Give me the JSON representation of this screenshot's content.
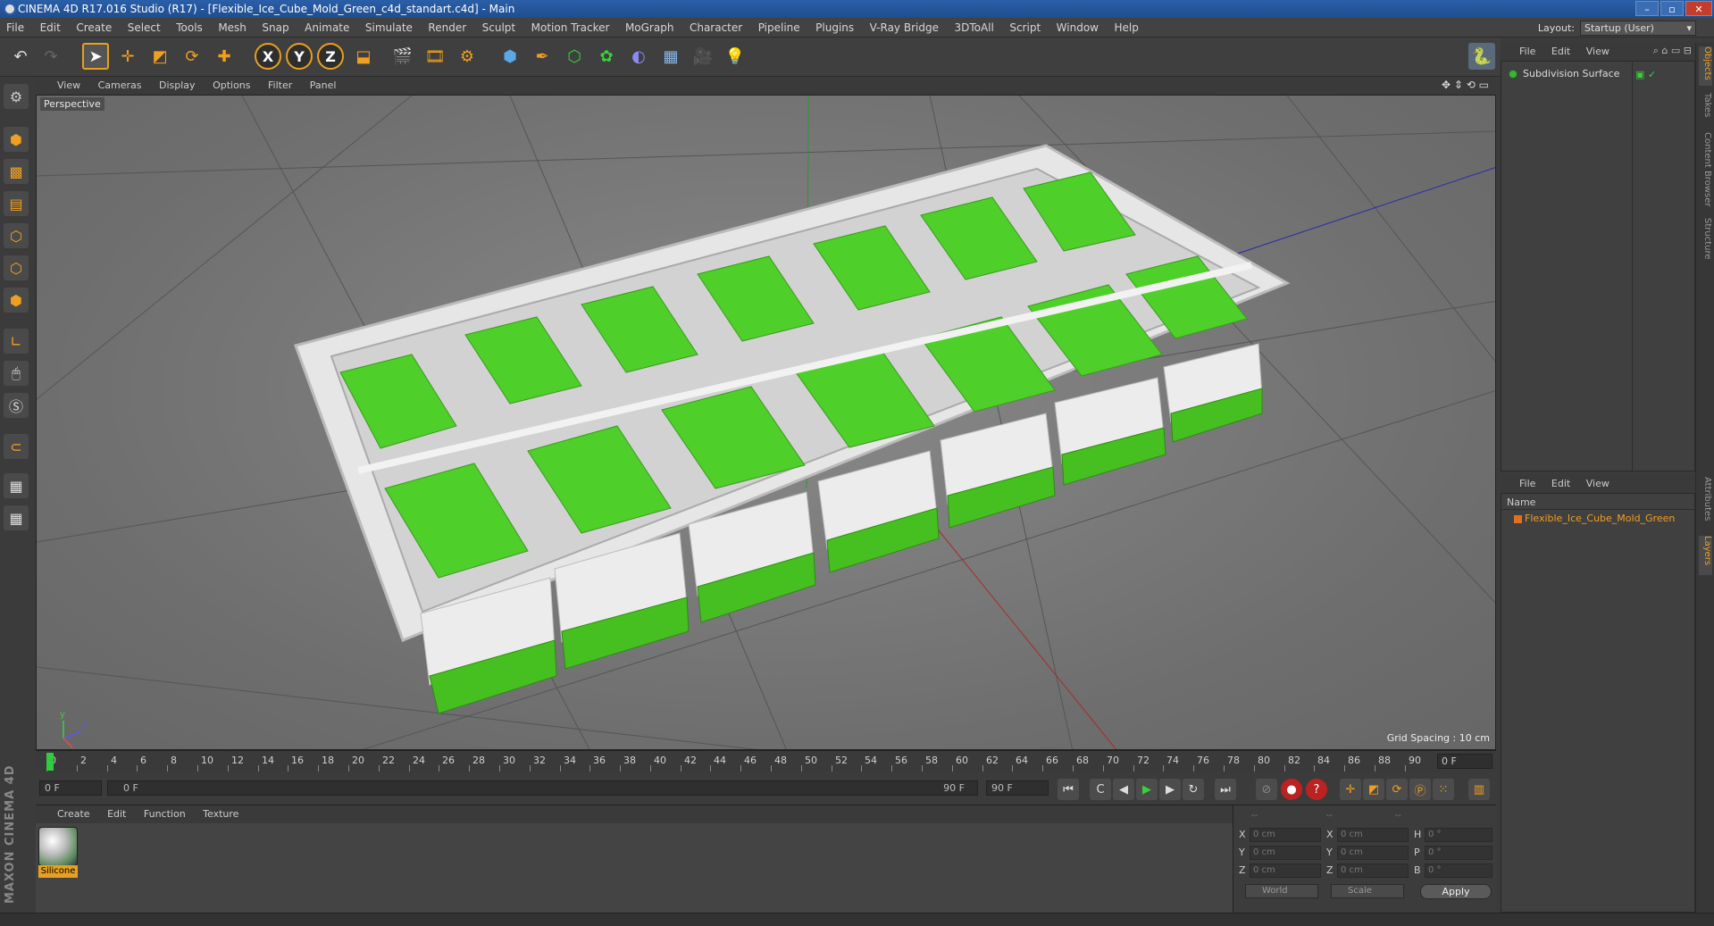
{
  "window": {
    "title": "CINEMA 4D R17.016 Studio (R17) - [Flexible_Ice_Cube_Mold_Green_c4d_standart.c4d] - Main"
  },
  "menubar": {
    "items": [
      "File",
      "Edit",
      "Create",
      "Select",
      "Tools",
      "Mesh",
      "Snap",
      "Animate",
      "Simulate",
      "Render",
      "Sculpt",
      "Motion Tracker",
      "MoGraph",
      "Character",
      "Pipeline",
      "Plugins",
      "V-Ray Bridge",
      "3DToAll",
      "Script",
      "Window",
      "Help"
    ],
    "layout_label": "Layout:",
    "layout_value": "Startup (User)"
  },
  "toolbar": {
    "axis_x": "X",
    "axis_y": "Y",
    "axis_z": "Z"
  },
  "viewport": {
    "menu": [
      "View",
      "Cameras",
      "Display",
      "Options",
      "Filter",
      "Panel"
    ],
    "label": "Perspective",
    "grid_spacing": "Grid Spacing : 10 cm",
    "axis_y": "y",
    "axis_z": "z"
  },
  "timeline": {
    "ticks": [
      "0",
      "2",
      "4",
      "6",
      "8",
      "10",
      "12",
      "14",
      "16",
      "18",
      "20",
      "22",
      "24",
      "26",
      "28",
      "30",
      "32",
      "34",
      "36",
      "38",
      "40",
      "42",
      "44",
      "46",
      "48",
      "50",
      "52",
      "54",
      "56",
      "58",
      "60",
      "62",
      "64",
      "66",
      "68",
      "70",
      "72",
      "74",
      "76",
      "78",
      "80",
      "82",
      "84",
      "86",
      "88",
      "90"
    ],
    "current_frame": "0 F"
  },
  "transport": {
    "start_frame": "0 F",
    "range_start": "0 F",
    "range_end": "90 F",
    "end_frame": "90 F"
  },
  "material_manager": {
    "menu": [
      "Create",
      "Edit",
      "Function",
      "Texture"
    ],
    "material_name": "Silicone",
    "brand": "MAXON CINEMA 4D"
  },
  "coordinates": {
    "rows": [
      {
        "label_a": "X",
        "value_a": "0 cm",
        "label_b": "X",
        "value_b": "0 cm",
        "label_c": "H",
        "value_c": "0 °"
      },
      {
        "label_a": "Y",
        "value_a": "0 cm",
        "label_b": "Y",
        "value_b": "0 cm",
        "label_c": "P",
        "value_c": "0 °"
      },
      {
        "label_a": "Z",
        "value_a": "0 cm",
        "label_b": "Z",
        "value_b": "0 cm",
        "label_c": "B",
        "value_c": "0 °"
      }
    ],
    "space_select": "World",
    "mode_select": "Scale",
    "apply_label": "Apply"
  },
  "object_manager": {
    "menu": [
      "File",
      "Edit",
      "View"
    ],
    "objects": [
      {
        "name": "Subdivision Surface"
      }
    ]
  },
  "layer_manager": {
    "menu": [
      "File",
      "Edit",
      "View"
    ],
    "header": "Name",
    "layers": [
      {
        "name": "Flexible_Ice_Cube_Mold_Green"
      }
    ]
  },
  "side_tabs": [
    "Objects",
    "Takes",
    "Content Browser",
    "Structure",
    "Attributes",
    "Layers"
  ],
  "colors": {
    "accent": "#f0a020",
    "silicone_green": "#4fcf2a",
    "titlebar": "#2a5fa8"
  }
}
